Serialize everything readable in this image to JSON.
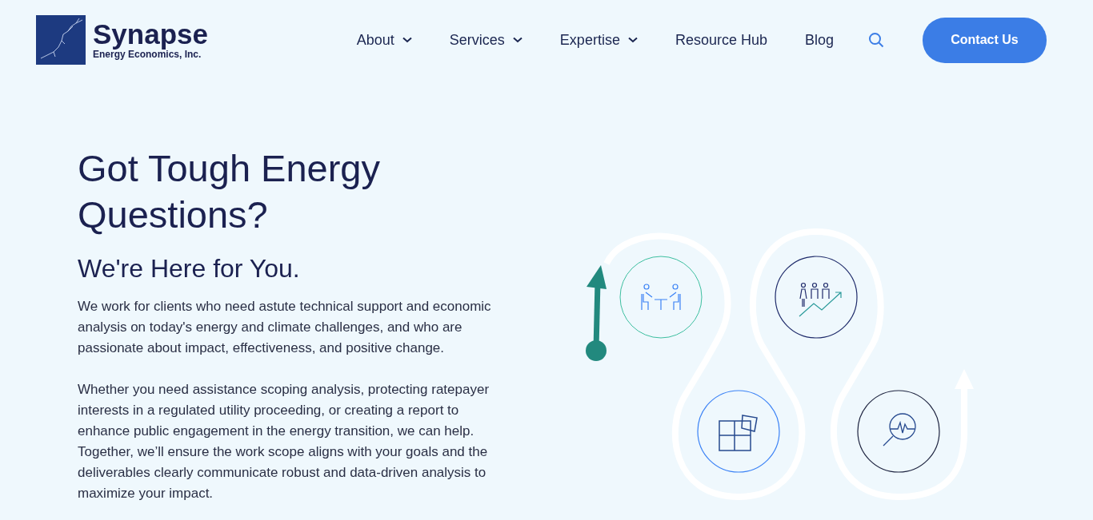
{
  "logo": {
    "name": "Synapse",
    "tagline": "Energy Economics, Inc."
  },
  "nav": [
    {
      "label": "About",
      "dropdown": true
    },
    {
      "label": "Services",
      "dropdown": true
    },
    {
      "label": "Expertise",
      "dropdown": true
    },
    {
      "label": "Resource Hub",
      "dropdown": false
    },
    {
      "label": "Blog",
      "dropdown": false
    }
  ],
  "contact_button": "Contact Us",
  "hero": {
    "title": "Got Tough Energy Questions?",
    "subtitle": "We're Here for You.",
    "paragraphs": [
      "We work for clients who need astute technical support and economic analysis on today's energy and climate challenges, and who are passionate about impact, effectiveness, and positive change.",
      "Whether you need assistance scoping analysis, protecting ratepayer interests in a regulated utility proceeding, or creating a report to enhance public engagement in the energy transition, we can help. Together, we’ll ensure the work scope aligns with your goals and the deliverables clearly communicate robust and data-driven analysis to maximize your impact."
    ]
  }
}
